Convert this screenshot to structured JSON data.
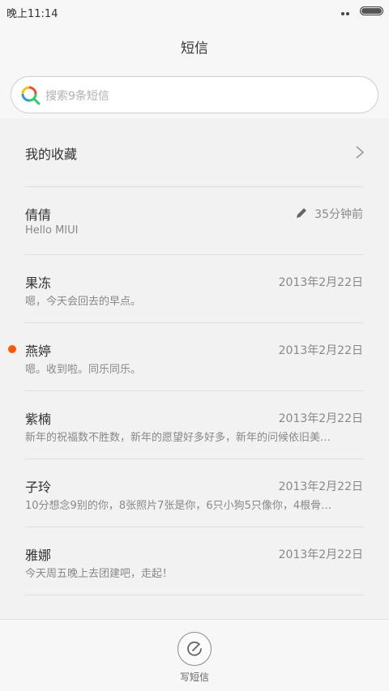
{
  "status_bar": {
    "time": "晚上11:14",
    "more_icon": "more-dots-icon",
    "battery_icon": "battery-icon"
  },
  "header": {
    "title": "短信"
  },
  "search": {
    "placeholder": "搜索9条短信",
    "icon": "search-icon",
    "icon_colors": [
      "#e74c3c",
      "#f1c40f",
      "#2ecc71",
      "#3498db"
    ]
  },
  "favorites": {
    "label": "我的收藏",
    "icon": "chevron-right-icon"
  },
  "messages": [
    {
      "name": "倩倩",
      "preview": "Hello MIUI",
      "time": "35分钟前",
      "draft": true,
      "unread": false
    },
    {
      "name": "果冻",
      "preview": "嗯，今天会回去的早点。",
      "time": "2013年2月22日",
      "draft": false,
      "unread": false
    },
    {
      "name": "燕婷",
      "preview": "嗯。收到啦。同乐同乐。",
      "time": "2013年2月22日",
      "draft": false,
      "unread": true
    },
    {
      "name": "紫楠",
      "preview": "新年的祝福数不胜数，新年的愿望好多好多，新年的问候依旧美…",
      "time": "2013年2月22日",
      "draft": false,
      "unread": false
    },
    {
      "name": "子玲",
      "preview": "10分想念9别的你，8张照片7张是你，6只小狗5只像你，4根骨…",
      "time": "2013年2月22日",
      "draft": false,
      "unread": false
    },
    {
      "name": "雅娜",
      "preview": "今天周五晚上去团建吧，走起！",
      "time": "2013年2月22日",
      "draft": false,
      "unread": false
    }
  ],
  "colors": {
    "unread_dot": "#ff5a00",
    "background": "#f2f2f2"
  },
  "bottom_bar": {
    "compose_label": "写短信",
    "compose_icon": "compose-icon"
  }
}
